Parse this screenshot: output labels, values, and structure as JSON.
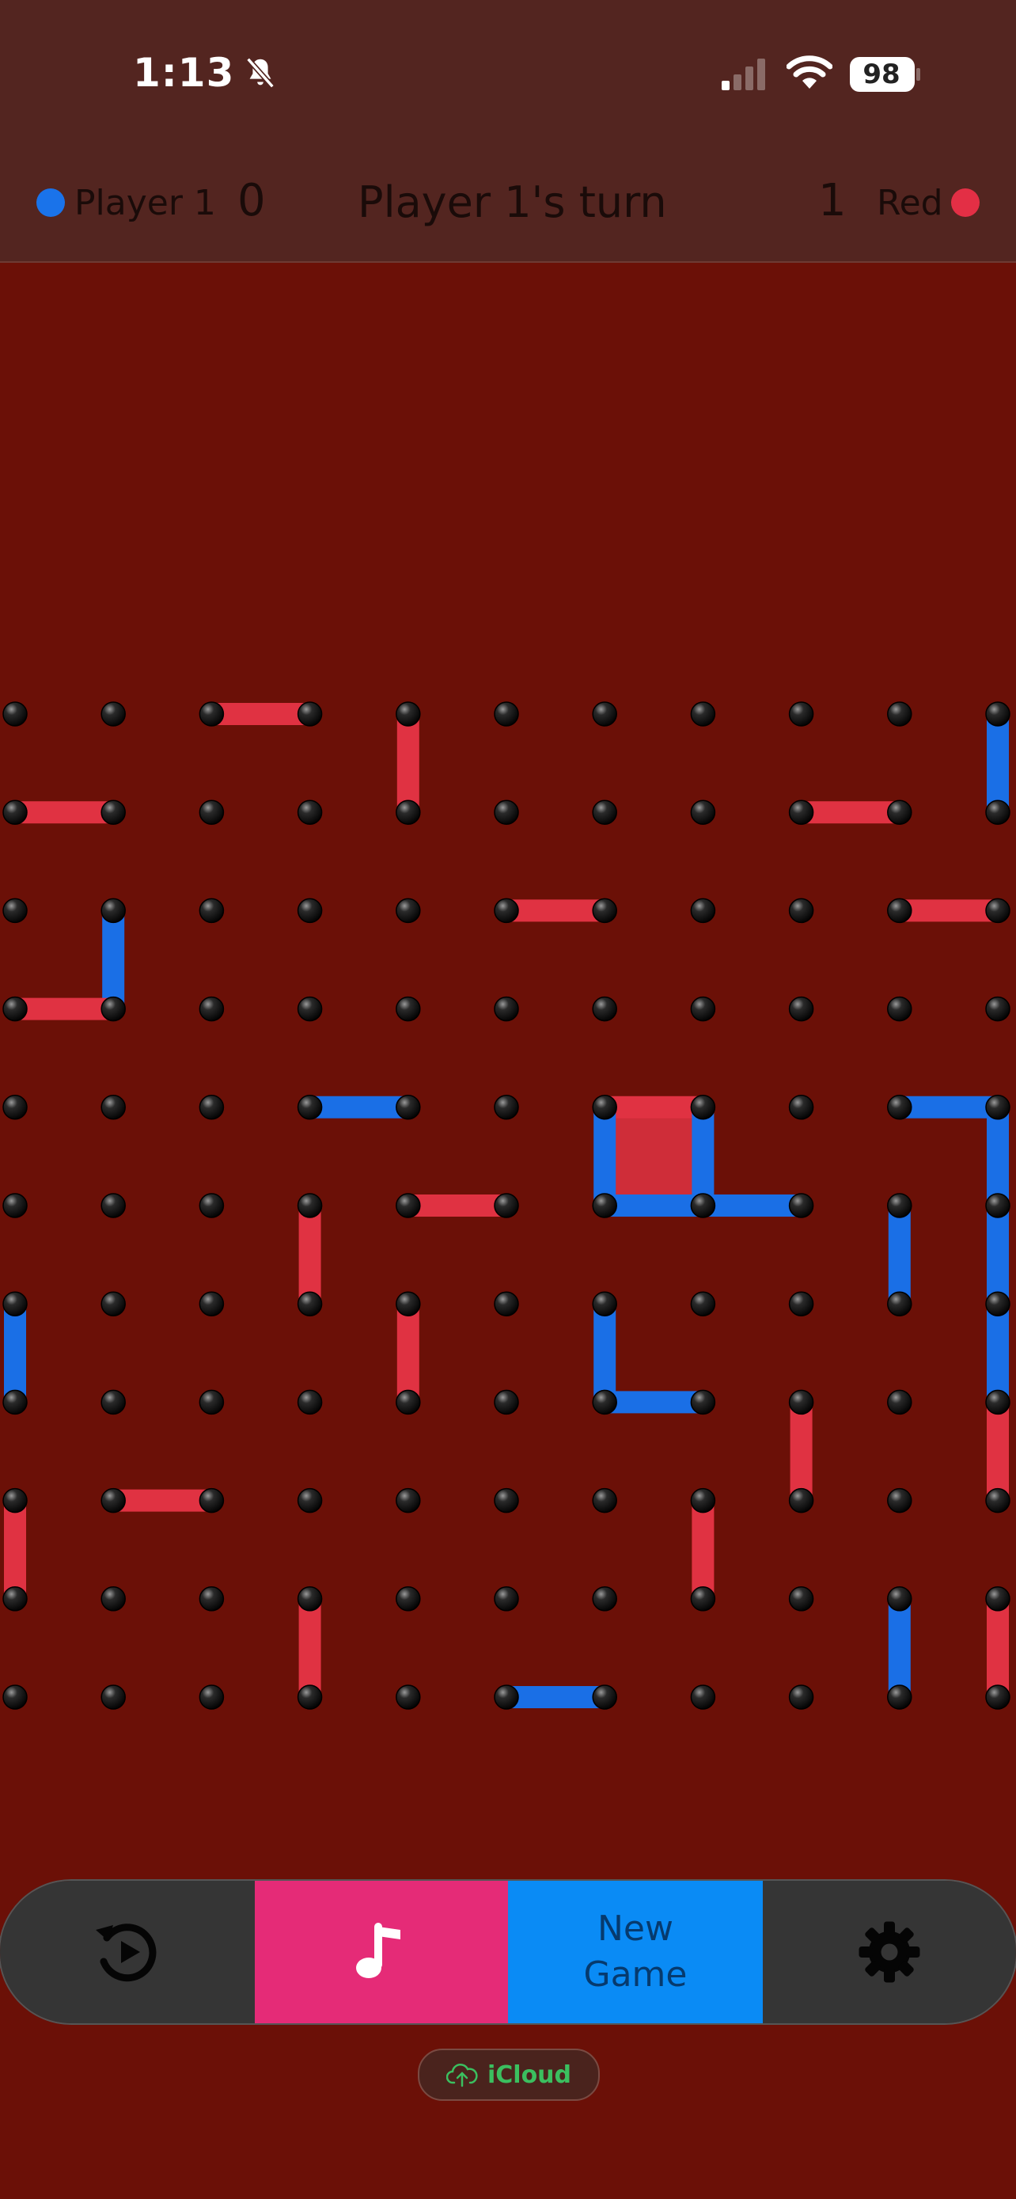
{
  "status": {
    "time": "1:13",
    "battery": "98"
  },
  "hud": {
    "left_player": "Player 1",
    "left_score": "0",
    "turn_text": "Player 1's turn",
    "right_score": "1",
    "right_player": "Red",
    "left_color": "#1a73ea",
    "right_color": "#e32f45"
  },
  "board": {
    "columns": 11,
    "rows": 11,
    "line_colors": {
      "blue": "#1a6fe6",
      "red": "#e03242"
    },
    "edges": [
      {
        "a": [
          2,
          0
        ],
        "b": [
          3,
          0
        ],
        "c": "red"
      },
      {
        "a": [
          4,
          0
        ],
        "b": [
          4,
          1
        ],
        "c": "red"
      },
      {
        "a": [
          10,
          0
        ],
        "b": [
          10,
          1
        ],
        "c": "blue"
      },
      {
        "a": [
          0,
          1
        ],
        "b": [
          1,
          1
        ],
        "c": "red"
      },
      {
        "a": [
          8,
          1
        ],
        "b": [
          9,
          1
        ],
        "c": "red"
      },
      {
        "a": [
          1,
          2
        ],
        "b": [
          1,
          3
        ],
        "c": "blue"
      },
      {
        "a": [
          5,
          2
        ],
        "b": [
          6,
          2
        ],
        "c": "red"
      },
      {
        "a": [
          9,
          2
        ],
        "b": [
          10,
          2
        ],
        "c": "red"
      },
      {
        "a": [
          0,
          3
        ],
        "b": [
          1,
          3
        ],
        "c": "red"
      },
      {
        "a": [
          3,
          4
        ],
        "b": [
          4,
          4
        ],
        "c": "blue"
      },
      {
        "a": [
          6,
          4
        ],
        "b": [
          7,
          4
        ],
        "c": "red"
      },
      {
        "a": [
          6,
          4
        ],
        "b": [
          6,
          5
        ],
        "c": "blue"
      },
      {
        "a": [
          7,
          4
        ],
        "b": [
          7,
          5
        ],
        "c": "blue"
      },
      {
        "a": [
          6,
          5
        ],
        "b": [
          7,
          5
        ],
        "c": "blue"
      },
      {
        "a": [
          7,
          5
        ],
        "b": [
          8,
          5
        ],
        "c": "blue"
      },
      {
        "a": [
          9,
          4
        ],
        "b": [
          10,
          4
        ],
        "c": "blue"
      },
      {
        "a": [
          10,
          4
        ],
        "b": [
          10,
          5
        ],
        "c": "blue"
      },
      {
        "a": [
          3,
          5
        ],
        "b": [
          3,
          6
        ],
        "c": "red"
      },
      {
        "a": [
          4,
          5
        ],
        "b": [
          5,
          5
        ],
        "c": "red"
      },
      {
        "a": [
          9,
          5
        ],
        "b": [
          9,
          6
        ],
        "c": "blue"
      },
      {
        "a": [
          10,
          5
        ],
        "b": [
          10,
          6
        ],
        "c": "blue"
      },
      {
        "a": [
          0,
          6
        ],
        "b": [
          0,
          7
        ],
        "c": "blue"
      },
      {
        "a": [
          4,
          6
        ],
        "b": [
          4,
          7
        ],
        "c": "red"
      },
      {
        "a": [
          6,
          6
        ],
        "b": [
          6,
          7
        ],
        "c": "blue"
      },
      {
        "a": [
          6,
          7
        ],
        "b": [
          7,
          7
        ],
        "c": "blue"
      },
      {
        "a": [
          10,
          6
        ],
        "b": [
          10,
          7
        ],
        "c": "blue"
      },
      {
        "a": [
          8,
          7
        ],
        "b": [
          8,
          8
        ],
        "c": "red"
      },
      {
        "a": [
          10,
          7
        ],
        "b": [
          10,
          8
        ],
        "c": "red"
      },
      {
        "a": [
          0,
          8
        ],
        "b": [
          0,
          9
        ],
        "c": "red"
      },
      {
        "a": [
          1,
          8
        ],
        "b": [
          2,
          8
        ],
        "c": "red"
      },
      {
        "a": [
          7,
          8
        ],
        "b": [
          7,
          9
        ],
        "c": "red"
      },
      {
        "a": [
          3,
          9
        ],
        "b": [
          3,
          10
        ],
        "c": "red"
      },
      {
        "a": [
          9,
          9
        ],
        "b": [
          9,
          10
        ],
        "c": "blue"
      },
      {
        "a": [
          10,
          9
        ],
        "b": [
          10,
          10
        ],
        "c": "red"
      },
      {
        "a": [
          5,
          10
        ],
        "b": [
          6,
          10
        ],
        "c": "blue"
      }
    ],
    "boxes": [
      {
        "cell": [
          6,
          4
        ],
        "c": "red"
      }
    ]
  },
  "toolbar": {
    "new_game_line1": "New",
    "new_game_line2": "Game"
  },
  "icloud": {
    "label": "iCloud"
  }
}
